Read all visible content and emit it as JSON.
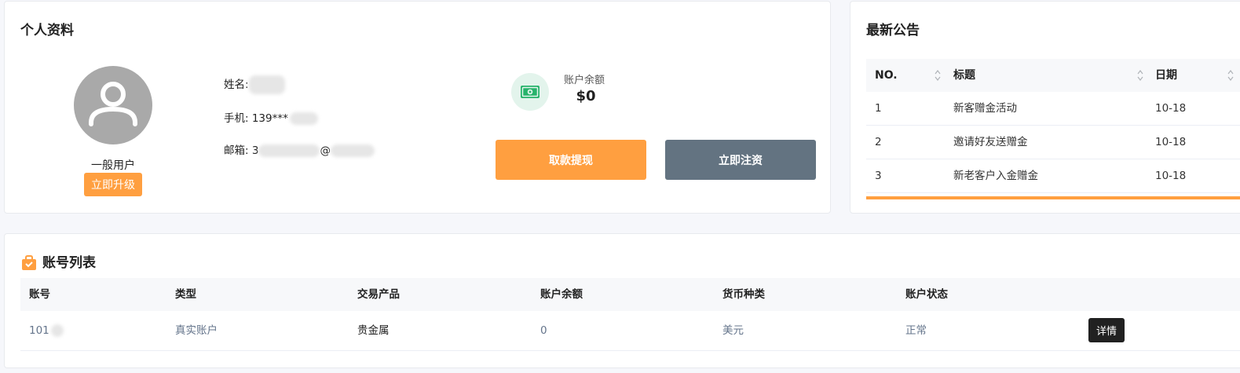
{
  "profile": {
    "title": "个人资料",
    "user_level": "一般用户",
    "upgrade_label": "立即升级",
    "name_label": "姓名:",
    "phone_label": "手机: 139***",
    "email_label_prefix": "邮箱: 3",
    "email_at": "@",
    "balance_label": "账户余额",
    "balance_value": "$0",
    "withdraw_label": "取款提现",
    "deposit_label": "立即注资",
    "icons": {
      "avatar": "user-avatar-icon",
      "balance": "money-icon"
    },
    "colors": {
      "accent": "#ff9f40",
      "secondary": "#637381",
      "money_icon": "#27b36b"
    }
  },
  "notice": {
    "title": "最新公告",
    "headers": [
      "NO.",
      "标题",
      "日期"
    ],
    "rows": [
      {
        "no": "1",
        "title": "新客赠金活动",
        "date": "10-18"
      },
      {
        "no": "2",
        "title": "邀请好友送赠金",
        "date": "10-18"
      },
      {
        "no": "3",
        "title": "新老客户入金赠金",
        "date": "10-18"
      }
    ]
  },
  "accounts": {
    "title": "账号列表",
    "headers": [
      "账号",
      "类型",
      "交易产品",
      "账户余额",
      "货币种类",
      "账户状态"
    ],
    "rows": [
      {
        "id": "101",
        "type": "真实账户",
        "product": "贵金属",
        "balance": "0",
        "currency": "美元",
        "status": "正常",
        "action": "详情"
      }
    ]
  }
}
